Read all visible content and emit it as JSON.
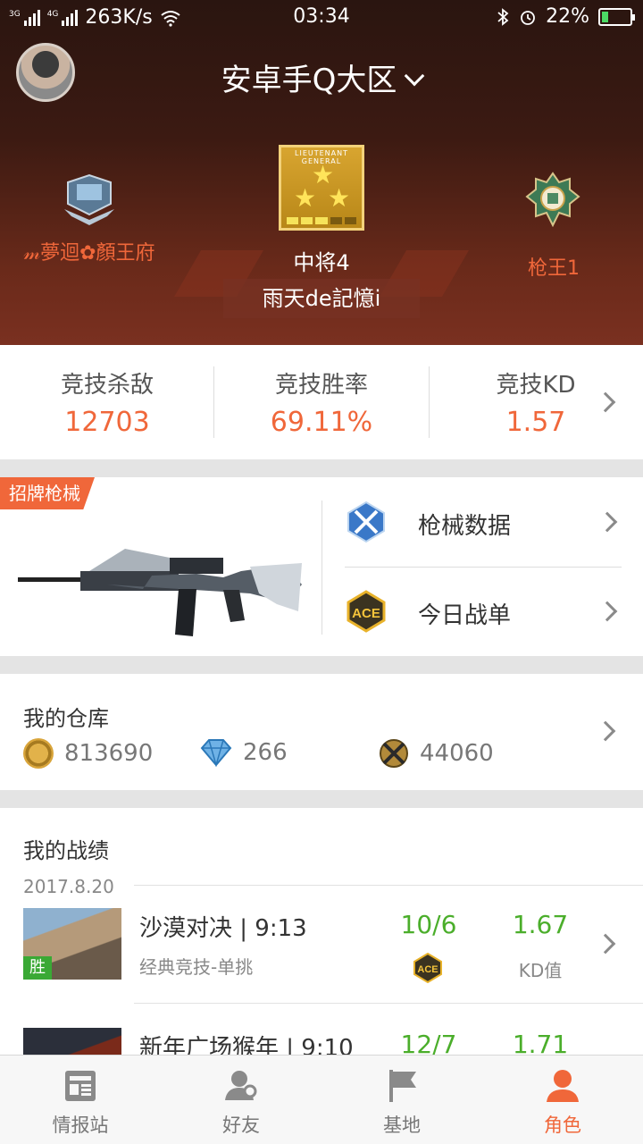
{
  "status_bar": {
    "network_left": "3G",
    "network_right": "4G",
    "speed": "263K/s",
    "time": "03:34",
    "battery": "22%",
    "battery_level": 0.22
  },
  "header": {
    "server": "安卓手Q大区",
    "guild": "𝓂夢迴✿顏王府",
    "rank_insignia_text": "LIEUTENANT GENERAL",
    "rank": "中将4",
    "player_name": "雨天de記憶i",
    "title": "枪王1"
  },
  "stats": [
    {
      "label": "竞技杀敌",
      "value": "12703"
    },
    {
      "label": "竞技胜率",
      "value": "69.11%"
    },
    {
      "label": "竞技KD",
      "value": "1.57"
    }
  ],
  "weapon": {
    "tag": "招牌枪械",
    "menu": [
      {
        "label": "枪械数据",
        "icon": "weapon-data-icon"
      },
      {
        "label": "今日战单",
        "icon": "ace-icon",
        "icon_text": "ACE"
      }
    ]
  },
  "warehouse": {
    "title": "我的仓库",
    "gold": "813690",
    "diamonds": "266",
    "honor": "44060"
  },
  "records": {
    "title": "我的战绩",
    "date": "2017.8.20",
    "matches": [
      {
        "result": "胜",
        "title": "沙漠对决 | 9:13",
        "mode": "经典竞技-单挑",
        "kd": "10/6",
        "ratio": "1.67",
        "ratio_label": "KD值",
        "ace": "ACE"
      },
      {
        "title": "新年广场猴年 | 9:10",
        "kd": "12/7",
        "ratio": "1.71"
      }
    ]
  },
  "nav": [
    {
      "label": "情报站",
      "icon": "news-icon"
    },
    {
      "label": "好友",
      "icon": "friends-icon"
    },
    {
      "label": "基地",
      "icon": "flag-icon"
    },
    {
      "label": "角色",
      "icon": "profile-icon",
      "active": true
    }
  ],
  "colors": {
    "accent": "#f0673a",
    "green": "#4bae2b"
  }
}
